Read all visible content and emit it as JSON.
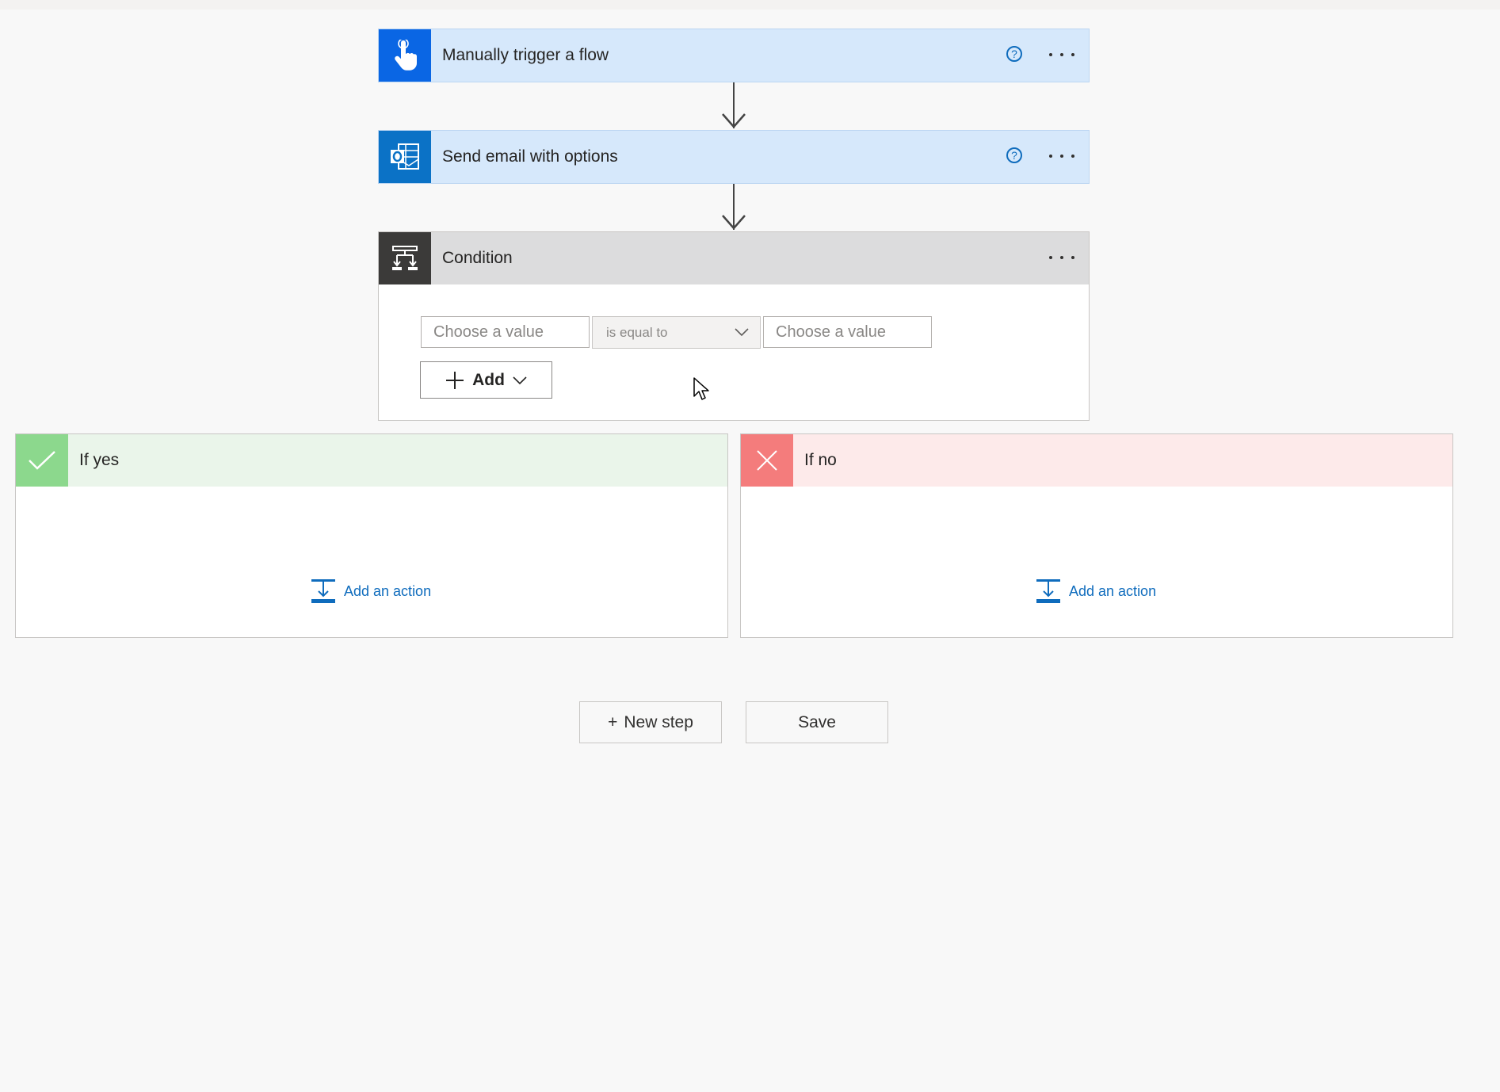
{
  "steps": {
    "trigger": {
      "title": "Manually trigger a flow",
      "icon": "hand-pointer-icon"
    },
    "email": {
      "title": "Send email with options",
      "icon": "outlook-icon"
    },
    "condition": {
      "title": "Condition",
      "icon": "condition-icon",
      "left_value_placeholder": "Choose a value",
      "operator": "is equal to",
      "right_value_placeholder": "Choose a value",
      "add_label": "Add"
    }
  },
  "branches": {
    "yes": {
      "title": "If yes",
      "add_action": "Add an action"
    },
    "no": {
      "title": "If no",
      "add_action": "Add an action"
    }
  },
  "footer": {
    "new_step_label": "New step",
    "new_step_prefix": "+",
    "save_label": "Save"
  },
  "colors": {
    "trigger_accent": "#0a66e4",
    "email_accent": "#0b72c6",
    "condition_accent": "#3b3a39",
    "yes_accent": "#8cd88d",
    "no_accent": "#f47c7c",
    "link": "#0f6cbd"
  }
}
